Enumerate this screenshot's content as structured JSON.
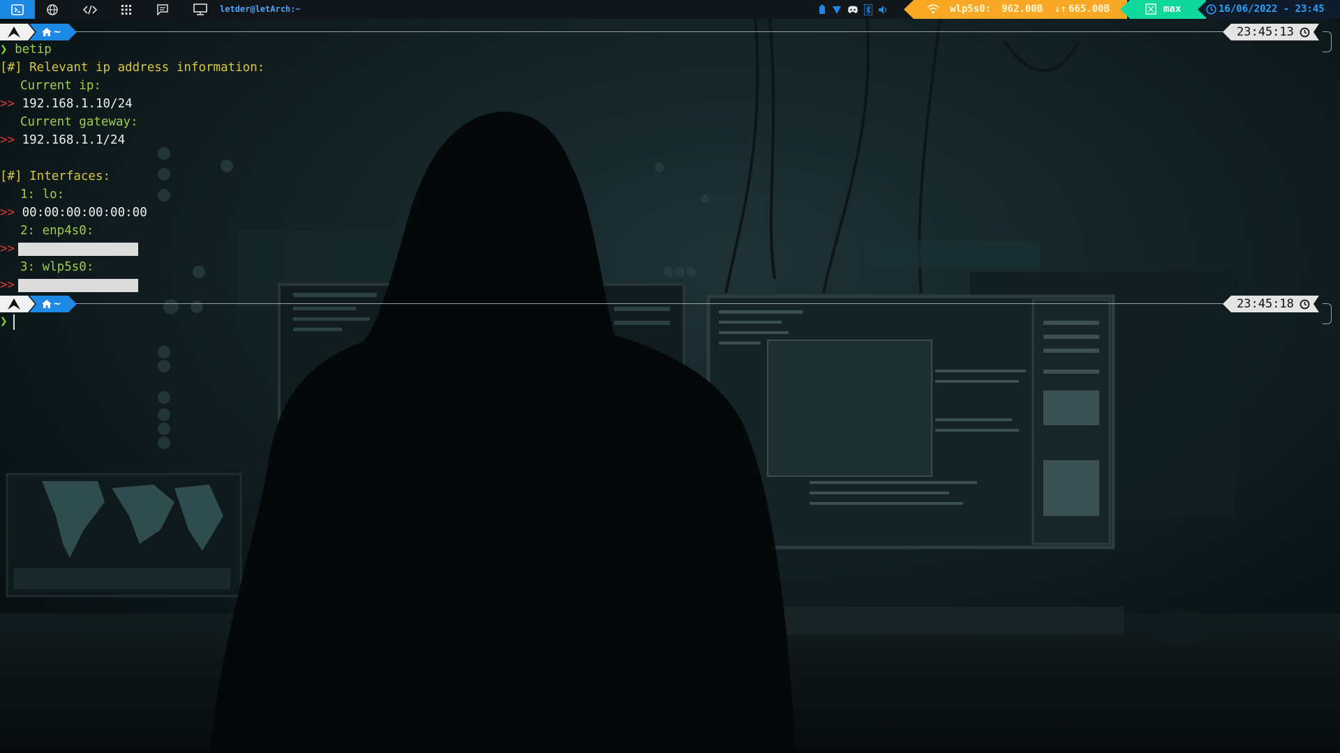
{
  "topbar": {
    "window_title": "letder@letArch:~",
    "workspace_icons": [
      "terminal-icon",
      "globe-icon",
      "code-icon",
      "apps-grid-icon",
      "chat-icon",
      "monitor-icon"
    ],
    "tray_icons": [
      "battery-icon",
      "shield-icon",
      "discord-icon",
      "bluetooth-icon",
      "volume-icon"
    ],
    "network": {
      "interface": "wlp5s0:",
      "down": "962.00B",
      "up": "665.00B",
      "icon": "wifi-icon"
    },
    "layout_label": "max",
    "datetime": "16/06/2022 - 23:45",
    "colors": {
      "active_workspace": "#1e88e5",
      "network_segment": "#f9a825",
      "layout_segment": "#0fd89a",
      "date_text": "#29a3ff"
    }
  },
  "prompt": {
    "home_label": "~",
    "first_time": "23:45:13",
    "second_time": "23:45:18"
  },
  "terminal": {
    "command": "betip",
    "arrow": ">>",
    "relevant_header": "[#] Relevant ip address information:",
    "current_ip_label": "Current ip:",
    "current_ip": "192.168.1.10/24",
    "gateway_label": "Current gateway:",
    "gateway": "192.168.1.1/24",
    "interfaces_header": "[#] Interfaces:",
    "iface_lo": "1: lo:",
    "lo_mac": "00:00:00:00:00:00",
    "iface_enp": "2: enp4s0:",
    "iface_wlp": "3: wlp5s0:"
  }
}
